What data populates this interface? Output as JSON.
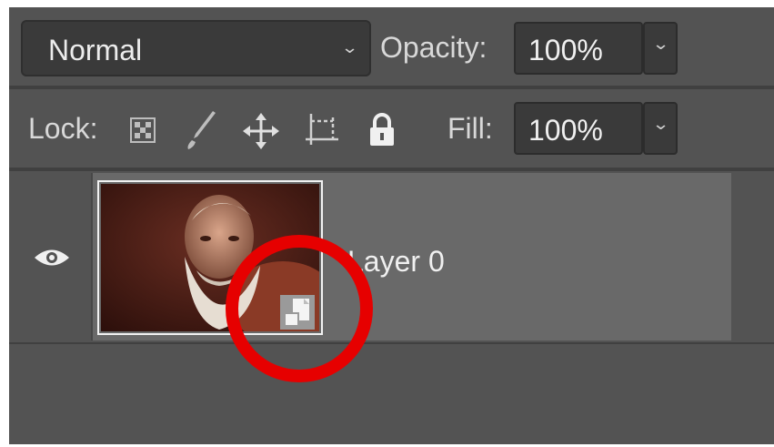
{
  "options_bar": {
    "blend_mode": "Normal",
    "opacity_label": "Opacity:",
    "opacity_value": "100%"
  },
  "lock_bar": {
    "lock_label": "Lock:",
    "lock_icons": [
      "lock-transparent-pixels-icon",
      "lock-image-pixels-icon",
      "lock-position-icon",
      "lock-artboard-icon",
      "lock-all-icon"
    ],
    "fill_label": "Fill:",
    "fill_value": "100%"
  },
  "layers": [
    {
      "name": "Layer 0",
      "visible": true,
      "smart_object": true
    }
  ],
  "colors": {
    "panel_bg": "#535353",
    "selected_layer_bg": "#696969",
    "field_bg": "#3a3a3a",
    "annotation": "#e60000"
  }
}
